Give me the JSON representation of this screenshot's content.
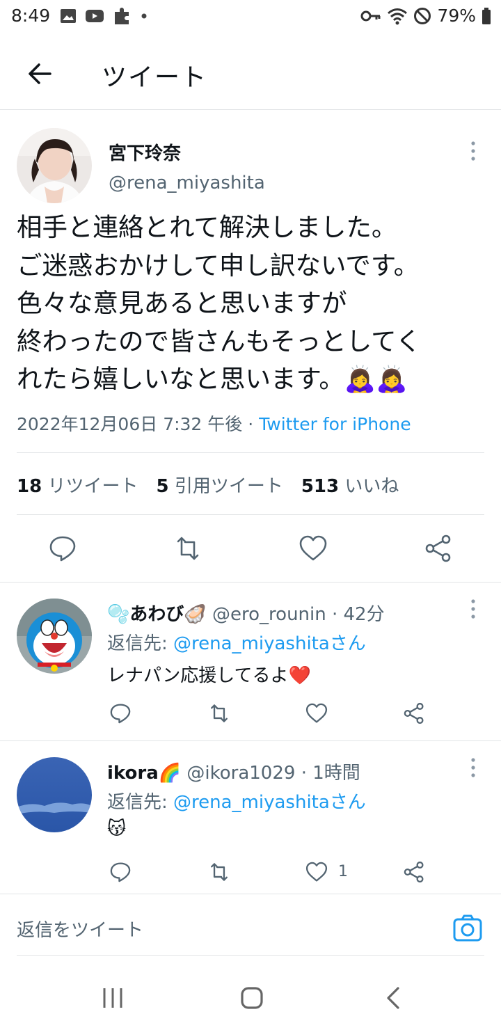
{
  "status_bar": {
    "time": "8:49",
    "battery": "79%"
  },
  "header": {
    "title": "ツイート"
  },
  "main_tweet": {
    "author_name": "宮下玲奈",
    "author_handle": "@rena_miyashita",
    "text_lines": [
      "相手と連絡とれて解決しました。",
      "ご迷惑おかけして申し訳ないです。",
      "色々な意見あると思いますが",
      "終わったので皆さんもそっとしてく",
      "れたら嬉しいなと思います。🙇‍♀️🙇‍♀️"
    ],
    "timestamp": "2022年12月06日 7:32 午後 · ",
    "source": "Twitter for iPhone",
    "retweet_count": "18",
    "retweet_label": "リツイート",
    "quote_count": "5",
    "quote_label": "引用ツイート",
    "like_count": "513",
    "like_label": "いいね"
  },
  "replies": [
    {
      "name": "🫧あわび🦪",
      "handle": "@ero_rounin · 42分",
      "reply_to_prefix": "返信先: ",
      "reply_to": "@rena_miyashitaさん",
      "text": "レナパン応援してるよ❤️",
      "like_count": ""
    },
    {
      "name": "ikora🌈",
      "handle": "@ikora1029 · 1時間",
      "reply_to_prefix": "返信先: ",
      "reply_to": "@rena_miyashitaさん",
      "text": "😽",
      "like_count": "1"
    }
  ],
  "composer": {
    "placeholder": "返信をツイート"
  },
  "colors": {
    "accent": "#1d9bf0",
    "secondary_text": "#536471",
    "divider": "#e1e4e6"
  }
}
